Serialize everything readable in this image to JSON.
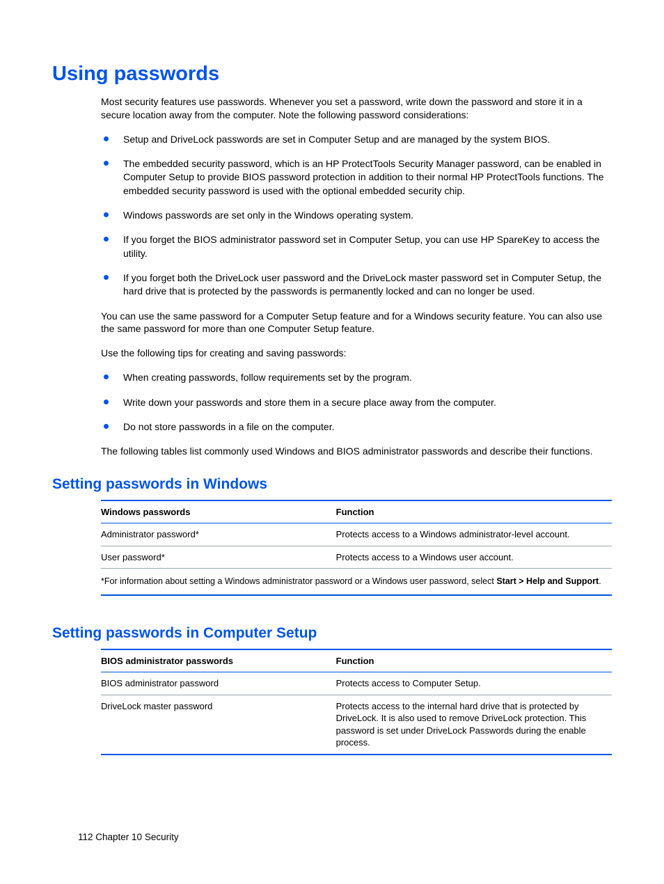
{
  "heading": "Using passwords",
  "intro": "Most security features use passwords. Whenever you set a password, write down the password and store it in a secure location away from the computer. Note the following password considerations:",
  "bullets1": {
    "b0": "Setup and DriveLock passwords are set in Computer Setup and are managed by the system BIOS.",
    "b1": "The embedded security password, which is an HP ProtectTools Security Manager password, can be enabled in Computer Setup to provide BIOS password protection in addition to their normal HP ProtectTools functions. The embedded security password is used with the optional embedded security chip.",
    "b2": "Windows passwords are set only in the Windows operating system.",
    "b3": "If you forget the BIOS administrator password set in Computer Setup, you can use HP SpareKey to access the utility.",
    "b4": "If you forget both the DriveLock user password and the DriveLock master password set in Computer Setup, the hard drive that is protected by the passwords is permanently locked and can no longer be used."
  },
  "para2": "You can use the same password for a Computer Setup feature and for a Windows security feature. You can also use the same password for more than one Computer Setup feature.",
  "para3": "Use the following tips for creating and saving passwords:",
  "bullets2": {
    "b0": "When creating passwords, follow requirements set by the program.",
    "b1": "Write down your passwords and store them in a secure place away from the computer.",
    "b2": "Do not store passwords in a file on the computer."
  },
  "para4": "The following tables list commonly used Windows and BIOS administrator passwords and describe their functions.",
  "section_windows": {
    "heading": "Setting passwords in Windows",
    "th1": "Windows passwords",
    "th2": "Function",
    "r0c0": "Administrator password*",
    "r0c1": "Protects access to a Windows administrator-level account.",
    "r1c0": "User password*",
    "r1c1": "Protects access to a Windows user account.",
    "footnote_pre": "*For information about setting a Windows administrator password or a Windows user password, select ",
    "footnote_bold": "Start > Help and Support",
    "footnote_post": "."
  },
  "section_cs": {
    "heading": "Setting passwords in Computer Setup",
    "th1": "BIOS administrator passwords",
    "th2": "Function",
    "r0c0": "BIOS administrator password",
    "r0c1": "Protects access to Computer Setup.",
    "r1c0": "DriveLock master password",
    "r1c1": "Protects access to the internal hard drive that is protected by DriveLock. It is also used to remove DriveLock protection. This password is set under DriveLock Passwords during the enable process."
  },
  "footer": "112   Chapter 10   Security"
}
